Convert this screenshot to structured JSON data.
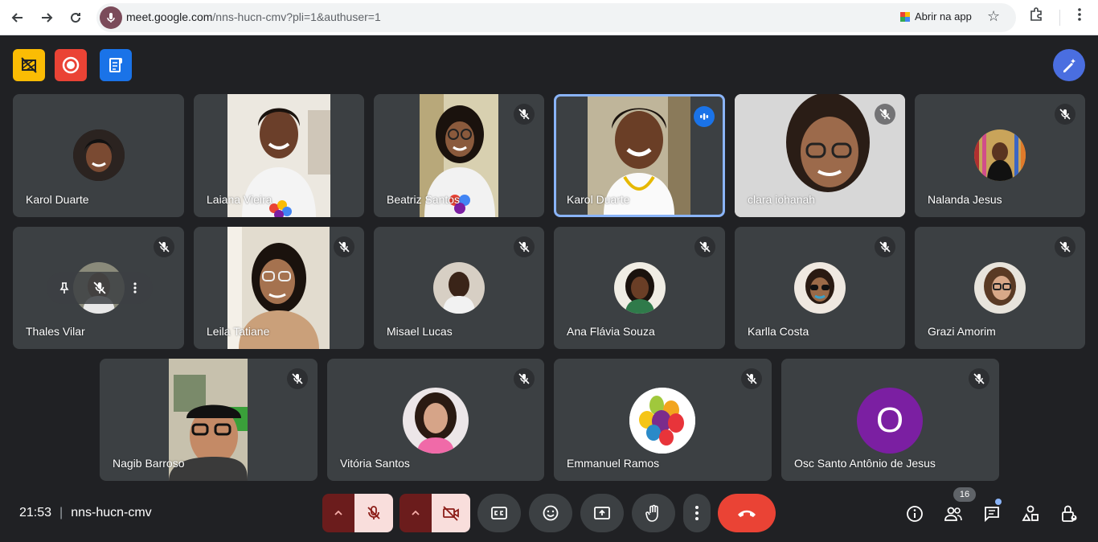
{
  "browser": {
    "url_host": "meet.google.com",
    "url_path": "/nns-hucn-cmv?pli=1&authuser=1",
    "open_app_label": "Abrir na app"
  },
  "meeting": {
    "time": "21:53",
    "code": "nns-hucn-cmv",
    "participant_count": "16"
  },
  "participants": [
    {
      "name": "Karol Duarte"
    },
    {
      "name": "Laiana Vieira"
    },
    {
      "name": "Beatriz Santos"
    },
    {
      "name": "Karol Duarte"
    },
    {
      "name": "clara iohanah"
    },
    {
      "name": "Nalanda Jesus"
    },
    {
      "name": "Thales Vilar"
    },
    {
      "name": "Leila Tatiane"
    },
    {
      "name": "Misael Lucas"
    },
    {
      "name": "Ana Flávia Souza"
    },
    {
      "name": "Karlla Costa"
    },
    {
      "name": "Grazi Amorim"
    },
    {
      "name": "Nagib Barroso"
    },
    {
      "name": "Vitória Santos"
    },
    {
      "name": "Emmanuel Ramos"
    },
    {
      "name": "Osc Santo Antônio de Jesus",
      "initial": "O"
    }
  ],
  "colors": {
    "background": "#202124",
    "tile": "#3c4043",
    "accent": "#8ab4f8",
    "end_call": "#ea4335",
    "speaking": "#1a73e8"
  }
}
